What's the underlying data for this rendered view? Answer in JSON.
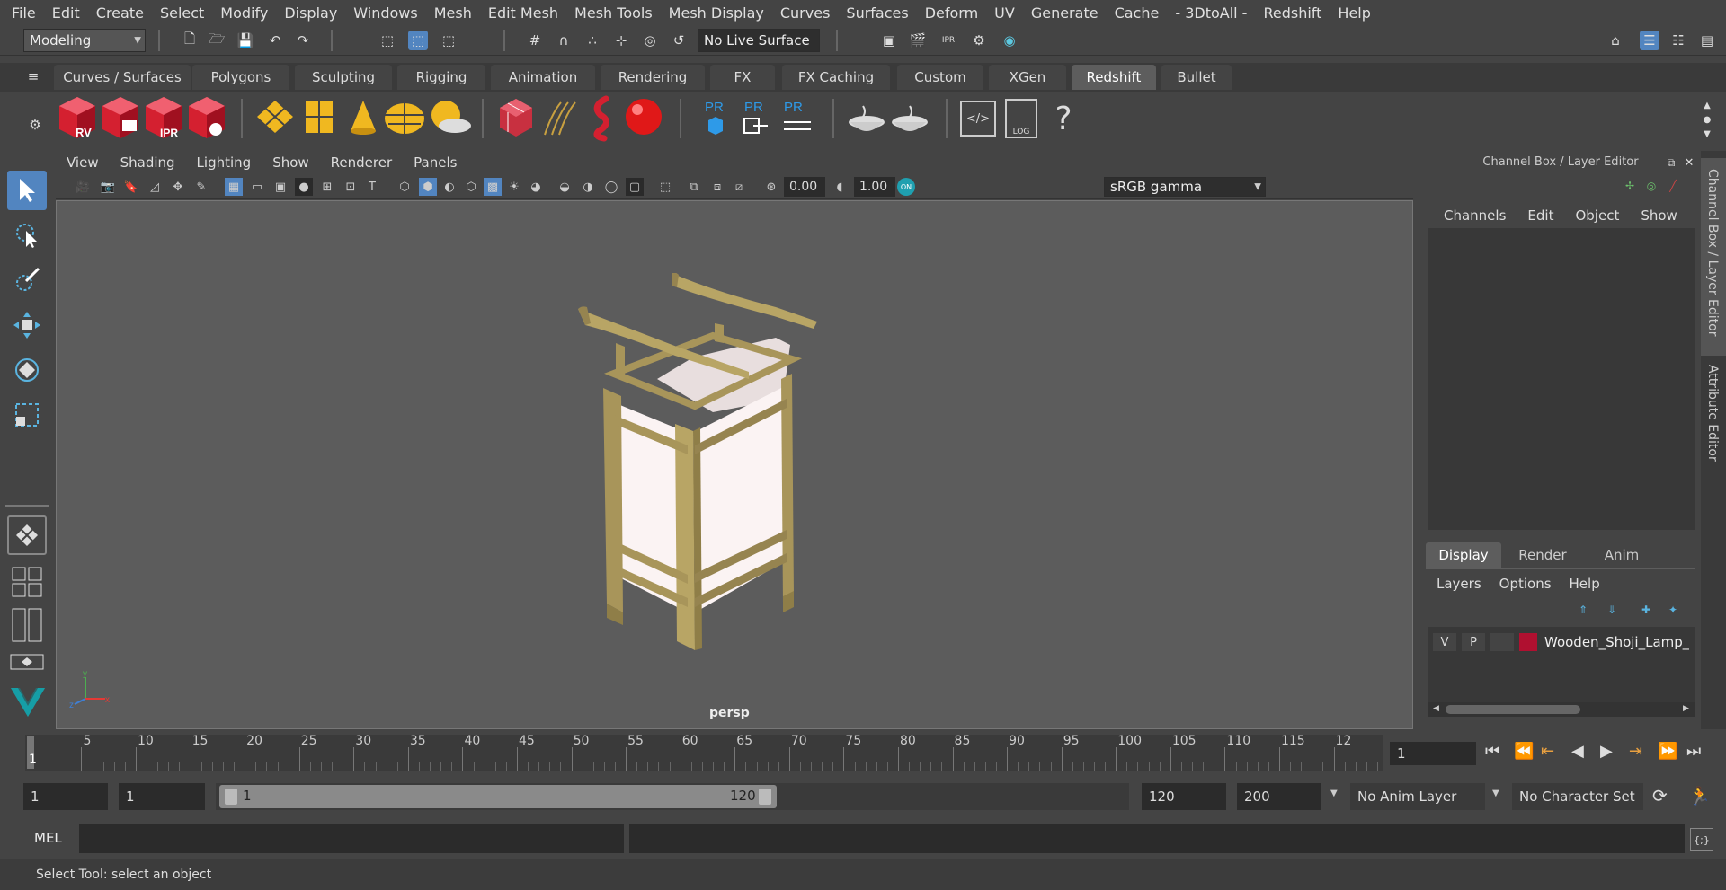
{
  "menubar": [
    "File",
    "Edit",
    "Create",
    "Select",
    "Modify",
    "Display",
    "Windows",
    "Mesh",
    "Edit Mesh",
    "Mesh Tools",
    "Mesh Display",
    "Curves",
    "Surfaces",
    "Deform",
    "UV",
    "Generate",
    "Cache",
    "- 3DtoAll -",
    "Redshift",
    "Help"
  ],
  "status": {
    "mode": "Modeling",
    "live_surface": "No Live Surface"
  },
  "shelf_tabs": [
    "Curves / Surfaces",
    "Polygons",
    "Sculpting",
    "Rigging",
    "Animation",
    "Rendering",
    "FX",
    "FX Caching",
    "Custom",
    "XGen",
    "Redshift",
    "Bullet"
  ],
  "active_shelf": "Redshift",
  "shelf_icons": {
    "rv": "RV",
    "ipr": "IPR",
    "pr": "PR",
    "log": "LOG",
    "help": "?"
  },
  "viewport": {
    "menus": [
      "View",
      "Shading",
      "Lighting",
      "Show",
      "Renderer",
      "Panels"
    ],
    "exposure": "0.00",
    "gamma": "1.00",
    "colorspace": "sRGB gamma",
    "camera": "persp",
    "axis_x": "x",
    "axis_y": "y",
    "axis_z": "z"
  },
  "channel_box": {
    "title": "Channel Box / Layer Editor",
    "menus": [
      "Channels",
      "Edit",
      "Object",
      "Show"
    ],
    "layer_tabs": [
      "Display",
      "Render",
      "Anim"
    ],
    "active_layer_tab": "Display",
    "layer_menus": [
      "Layers",
      "Options",
      "Help"
    ],
    "layer": {
      "v": "V",
      "p": "P",
      "name": "Wooden_Shoji_Lamp_",
      "color": "#b01030"
    }
  },
  "side_tabs": [
    "Channel Box / Layer Editor",
    "Attribute Editor"
  ],
  "timeline": {
    "ticks": [
      "5",
      "10",
      "15",
      "20",
      "25",
      "30",
      "35",
      "40",
      "45",
      "50",
      "55",
      "60",
      "65",
      "70",
      "75",
      "80",
      "85",
      "90",
      "95",
      "100",
      "105",
      "110",
      "115",
      "12"
    ],
    "current_frame_label": "1",
    "current_frame": "1"
  },
  "range": {
    "start": "1",
    "playback_start": "1",
    "slider_start": "1",
    "slider_end": "120",
    "playback_end": "120",
    "end": "200",
    "anim_layer": "No Anim Layer",
    "character_set": "No Character Set"
  },
  "mel": {
    "label": "MEL"
  },
  "help_line": "Select Tool: select an object",
  "colors": {
    "accent": "#5285c0",
    "redshift_red": "#d42030",
    "wood": "#a8955a"
  }
}
